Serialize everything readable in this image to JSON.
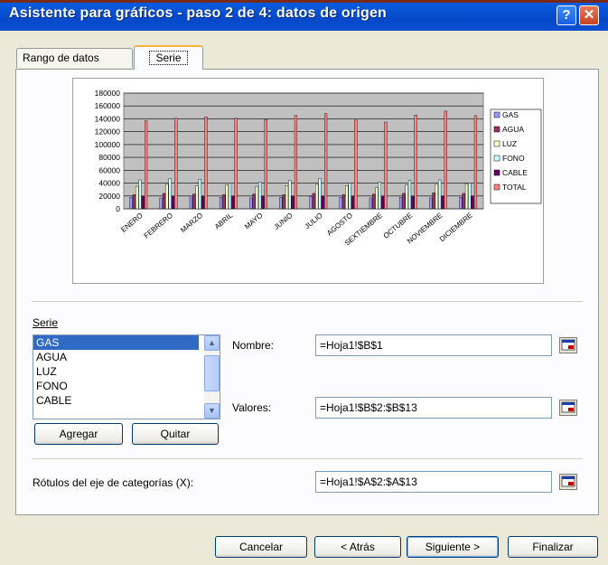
{
  "window": {
    "title": "Asistente para gráficos - paso 2 de 4: datos de origen",
    "help_label": "?",
    "close_label": "✕"
  },
  "tabs": [
    {
      "label": "Rango de datos"
    },
    {
      "label": "Serie"
    }
  ],
  "chart_data": {
    "type": "bar",
    "categories": [
      "ENERO",
      "FEBRERO",
      "MARZO",
      "ABRIL",
      "MAYO",
      "JUNIO",
      "JULIO",
      "AGOSTO",
      "SEPTIEMBRE",
      "OCTUBRE",
      "NOVIEMBRE",
      "DICIEMBRE"
    ],
    "category_labels_rendered": [
      "ENERO",
      "FEBRERO",
      "MARZO",
      "ABRIL",
      "MAYO",
      "JUNIO",
      "JULIO",
      "AGOSTO",
      "SEXTIEMBRE",
      "OCTUBRE",
      "NOVIEMBRE",
      "DICIEMBRE"
    ],
    "series": [
      {
        "name": "GAS",
        "color": "#9999ff",
        "values": [
          18000,
          17000,
          20000,
          18000,
          17000,
          18000,
          19000,
          18000,
          17000,
          18000,
          17000,
          18000
        ]
      },
      {
        "name": "AGUA",
        "color": "#993366",
        "values": [
          22000,
          24000,
          23000,
          22000,
          23000,
          22000,
          24000,
          22000,
          23000,
          24000,
          25000,
          24000
        ]
      },
      {
        "name": "LUZ",
        "color": "#ffffcc",
        "values": [
          35000,
          38000,
          36000,
          37000,
          35000,
          36000,
          38000,
          36000,
          33000,
          37000,
          38000,
          39000
        ]
      },
      {
        "name": "FONO",
        "color": "#ccffff",
        "values": [
          45000,
          47000,
          46000,
          40000,
          42000,
          44000,
          47000,
          40000,
          42000,
          44000,
          45000,
          40000
        ]
      },
      {
        "name": "CABLE",
        "color": "#660066",
        "values": [
          20000,
          20000,
          20000,
          20000,
          20000,
          20000,
          20000,
          20000,
          20000,
          20000,
          20000,
          20000
        ]
      },
      {
        "name": "TOTAL",
        "color": "#ff8080",
        "values": [
          137000,
          141000,
          143000,
          141000,
          139000,
          145000,
          148000,
          138000,
          135000,
          146000,
          152000,
          145000
        ]
      }
    ],
    "ylim": [
      0,
      180000
    ],
    "yticks": [
      "180000",
      "160000",
      "140000",
      "120000",
      "100000",
      "80000",
      "60000",
      "40000",
      "20000",
      "0"
    ],
    "plot_bg": "#c0c0c0",
    "grid": true,
    "legend": "right"
  },
  "series_section": {
    "label": "Serie",
    "items": [
      "GAS",
      "AGUA",
      "LUZ",
      "FONO",
      "CABLE"
    ],
    "selected": "GAS",
    "add_button": "Agregar",
    "remove_button": "Quitar"
  },
  "fields": {
    "nombre_label": "Nombre:",
    "nombre_value": "=Hoja1!$B$1",
    "valores_label": "Valores:",
    "valores_value": "=Hoja1!$B$2:$B$13",
    "rotulos_label": "Rótulos del eje de categorías (X):",
    "rotulos_value": "=Hoja1!$A$2:$A$13"
  },
  "buttons": {
    "cancel": "Cancelar",
    "back": "< Atrás",
    "next": "Siguiente >",
    "finish": "Finalizar"
  }
}
